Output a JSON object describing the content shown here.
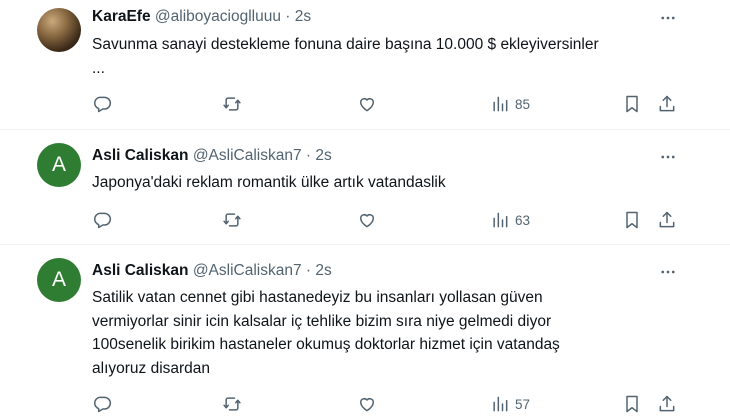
{
  "tweets": [
    {
      "name": "KaraEfe",
      "handle": "@aliboyacioglluuu",
      "separator": "·",
      "time": "2s",
      "avatar": "photo",
      "text_lines": [
        "Savunma sanayi destekleme fonuna daire başına 10.000 $ ekleyiversinler",
        "..."
      ],
      "views": "85"
    },
    {
      "name": "Asli Caliskan",
      "handle": "@AsliCaliskan7",
      "separator": "·",
      "time": "2s",
      "avatar_letter": "A",
      "text_lines": [
        "Japonya'daki reklam romantik ülke artık vatandaslik"
      ],
      "views": "63"
    },
    {
      "name": "Asli Caliskan",
      "handle": "@AsliCaliskan7",
      "separator": "·",
      "time": "2s",
      "avatar_letter": "A",
      "text_lines": [
        "Satilik vatan cennet gibi hastanedeyiz bu insanları yollasan güven",
        "vermiyorlar sinir icin kalsalar iç tehlike bizim sıra niye gelmedi diyor",
        "100senelik birikim hastaneler okumuş doktorlar hizmet için vatandaş",
        "alıyoruz disardan"
      ],
      "views": "57"
    }
  ],
  "colors": {
    "text": "#0f1419",
    "secondary": "#536471",
    "avatar_green": "#2f7d32",
    "divider": "#eff3f4"
  },
  "icons": [
    "more-icon",
    "reply-icon",
    "retweet-icon",
    "like-icon",
    "views-icon",
    "bookmark-icon",
    "share-icon"
  ]
}
